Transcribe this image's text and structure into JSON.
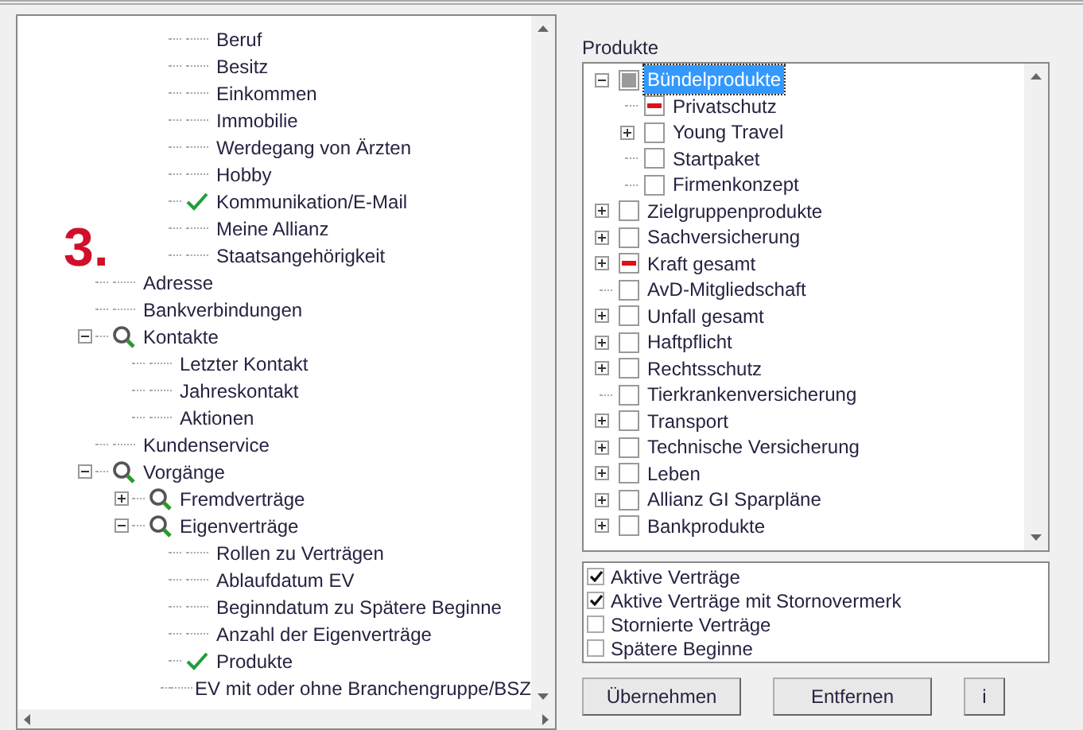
{
  "annotation": "3.",
  "left_tree": {
    "partial_branch": [
      {
        "label": "Beruf",
        "checked": false
      },
      {
        "label": "Besitz",
        "checked": false
      },
      {
        "label": "Einkommen",
        "checked": false
      },
      {
        "label": "Immobilie",
        "checked": false
      },
      {
        "label": "Werdegang von Ärzten",
        "checked": false
      },
      {
        "label": "Hobby",
        "checked": false
      },
      {
        "label": "Kommunikation/E-Mail",
        "checked": true
      },
      {
        "label": "Meine Allianz",
        "checked": false
      },
      {
        "label": "Staatsangehörigkeit",
        "checked": false
      }
    ],
    "items": [
      {
        "label": "Adresse",
        "checked": false
      },
      {
        "label": "Bankverbindungen",
        "checked": false
      },
      {
        "label": "Kontakte",
        "expanded": true,
        "children": [
          {
            "label": "Letzter Kontakt",
            "checked": false
          },
          {
            "label": "Jahreskontakt",
            "checked": false
          },
          {
            "label": "Aktionen",
            "checked": false
          }
        ]
      },
      {
        "label": "Kundenservice",
        "checked": false
      },
      {
        "label": "Vorgänge",
        "expanded": true,
        "children": [
          {
            "label": "Fremdverträge",
            "expanded": false
          },
          {
            "label": "Eigenverträge",
            "expanded": true,
            "children": [
              {
                "label": "Rollen zu Verträgen",
                "checked": false
              },
              {
                "label": "Ablaufdatum EV",
                "checked": false
              },
              {
                "label": "Beginndatum zu Spätere Beginne",
                "checked": false
              },
              {
                "label": "Anzahl der Eigenverträge",
                "checked": false
              },
              {
                "label": "Produkte",
                "checked": true
              },
              {
                "label": "EV mit oder ohne Branchengruppe/BSZ",
                "checked": false
              }
            ]
          }
        ]
      }
    ]
  },
  "products": {
    "title": "Produkte",
    "items": [
      {
        "label": "Bündelprodukte",
        "kind": "partial",
        "expanded": true,
        "selected": true,
        "children": [
          {
            "label": "Privatschutz",
            "kind": "excluded",
            "selected": false
          },
          {
            "label": "Young Travel",
            "kind": "unchecked",
            "expanded": false,
            "selected": false
          },
          {
            "label": "Startpaket",
            "kind": "unchecked",
            "selected": false
          },
          {
            "label": "Firmenkonzept",
            "kind": "unchecked",
            "selected": false
          }
        ]
      },
      {
        "label": "Zielgruppenprodukte",
        "kind": "unchecked",
        "expanded": false,
        "selected": false
      },
      {
        "label": "Sachversicherung",
        "kind": "unchecked",
        "expanded": false,
        "selected": false
      },
      {
        "label": "Kraft gesamt",
        "kind": "excluded",
        "expanded": false,
        "selected": false
      },
      {
        "label": "AvD-Mitgliedschaft",
        "kind": "unchecked",
        "selected": false
      },
      {
        "label": "Unfall gesamt",
        "kind": "unchecked",
        "expanded": false,
        "selected": false
      },
      {
        "label": "Haftpflicht",
        "kind": "unchecked",
        "expanded": false,
        "selected": false
      },
      {
        "label": "Rechtsschutz",
        "kind": "unchecked",
        "expanded": false,
        "selected": false
      },
      {
        "label": "Tierkrankenversicherung",
        "kind": "unchecked",
        "selected": false
      },
      {
        "label": "Transport",
        "kind": "unchecked",
        "expanded": false,
        "selected": false
      },
      {
        "label": "Technische Versicherung",
        "kind": "unchecked",
        "expanded": false,
        "selected": false
      },
      {
        "label": "Leben",
        "kind": "unchecked",
        "expanded": false,
        "selected": false
      },
      {
        "label": "Allianz GI Sparpläne",
        "kind": "unchecked",
        "expanded": false,
        "selected": false
      },
      {
        "label": "Bankprodukte",
        "kind": "unchecked",
        "expanded": false,
        "selected": false
      }
    ]
  },
  "filters": [
    {
      "label": "Aktive Verträge",
      "checked": true
    },
    {
      "label": "Aktive Verträge mit Stornovermerk",
      "checked": true
    },
    {
      "label": "Stornierte Verträge",
      "checked": false
    },
    {
      "label": "Spätere Beginne",
      "checked": false
    }
  ],
  "buttons": [
    {
      "label": "Übernehmen",
      "kind": "wide"
    },
    {
      "label": "Entfernen",
      "kind": "wide"
    },
    {
      "label": "i",
      "kind": "small"
    }
  ]
}
